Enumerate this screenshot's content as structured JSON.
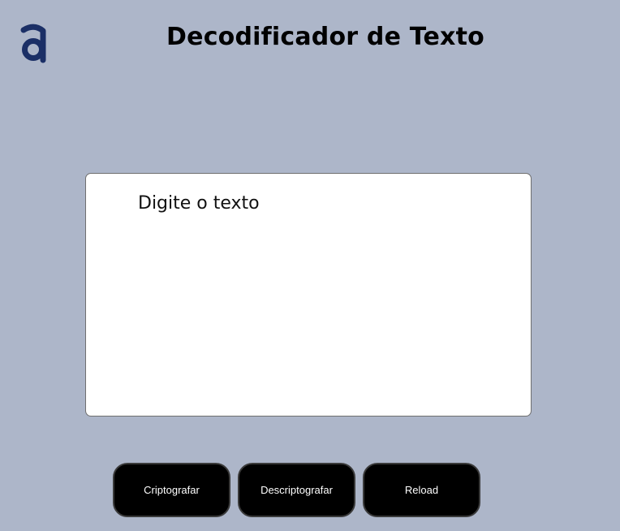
{
  "header": {
    "title": "Decodificador de Texto",
    "logo_icon": "alura-logo-icon",
    "logo_color": "#1b2f66"
  },
  "input": {
    "placeholder": "Digite o texto",
    "value": ""
  },
  "buttons": {
    "encrypt_label": "Criptografar",
    "decrypt_label": "Descriptografar",
    "reload_label": "Reload"
  },
  "colors": {
    "background": "#adb6c9",
    "button_bg": "#000000",
    "button_text": "#ffffff"
  }
}
